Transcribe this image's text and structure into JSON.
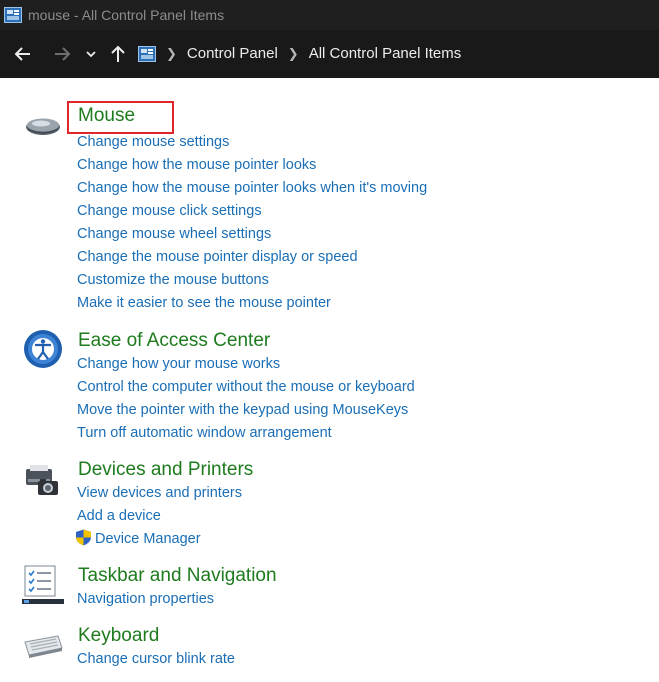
{
  "window": {
    "title": "mouse - All Control Panel Items"
  },
  "address": {
    "breadcrumbs": [
      "Control Panel",
      "All Control Panel Items"
    ]
  },
  "groups": [
    {
      "title": "Mouse",
      "icon": "mouse-icon",
      "links": [
        "Change mouse settings",
        "Change how the mouse pointer looks",
        "Change how the mouse pointer looks when it's moving",
        "Change mouse click settings",
        "Change mouse wheel settings",
        "Change the mouse pointer display or speed",
        "Customize the mouse buttons",
        "Make it easier to see the mouse pointer"
      ]
    },
    {
      "title": "Ease of Access Center",
      "icon": "ease-of-access-icon",
      "links": [
        "Change how your mouse works",
        "Control the computer without the mouse or keyboard",
        "Move the pointer with the keypad using MouseKeys",
        "Turn off automatic window arrangement"
      ]
    },
    {
      "title": "Devices and Printers",
      "icon": "devices-printers-icon",
      "links": [
        "View devices and printers",
        "Add a device",
        "Device Manager"
      ]
    },
    {
      "title": "Taskbar and Navigation",
      "icon": "taskbar-icon",
      "links": [
        "Navigation properties"
      ]
    },
    {
      "title": "Keyboard",
      "icon": "keyboard-icon",
      "links": [
        "Change cursor blink rate"
      ]
    }
  ],
  "colors": {
    "titlebar": "#1f1f1f",
    "group_title": "#1e7b1e",
    "link": "#1a6eb5",
    "highlight": "#e0262b"
  }
}
